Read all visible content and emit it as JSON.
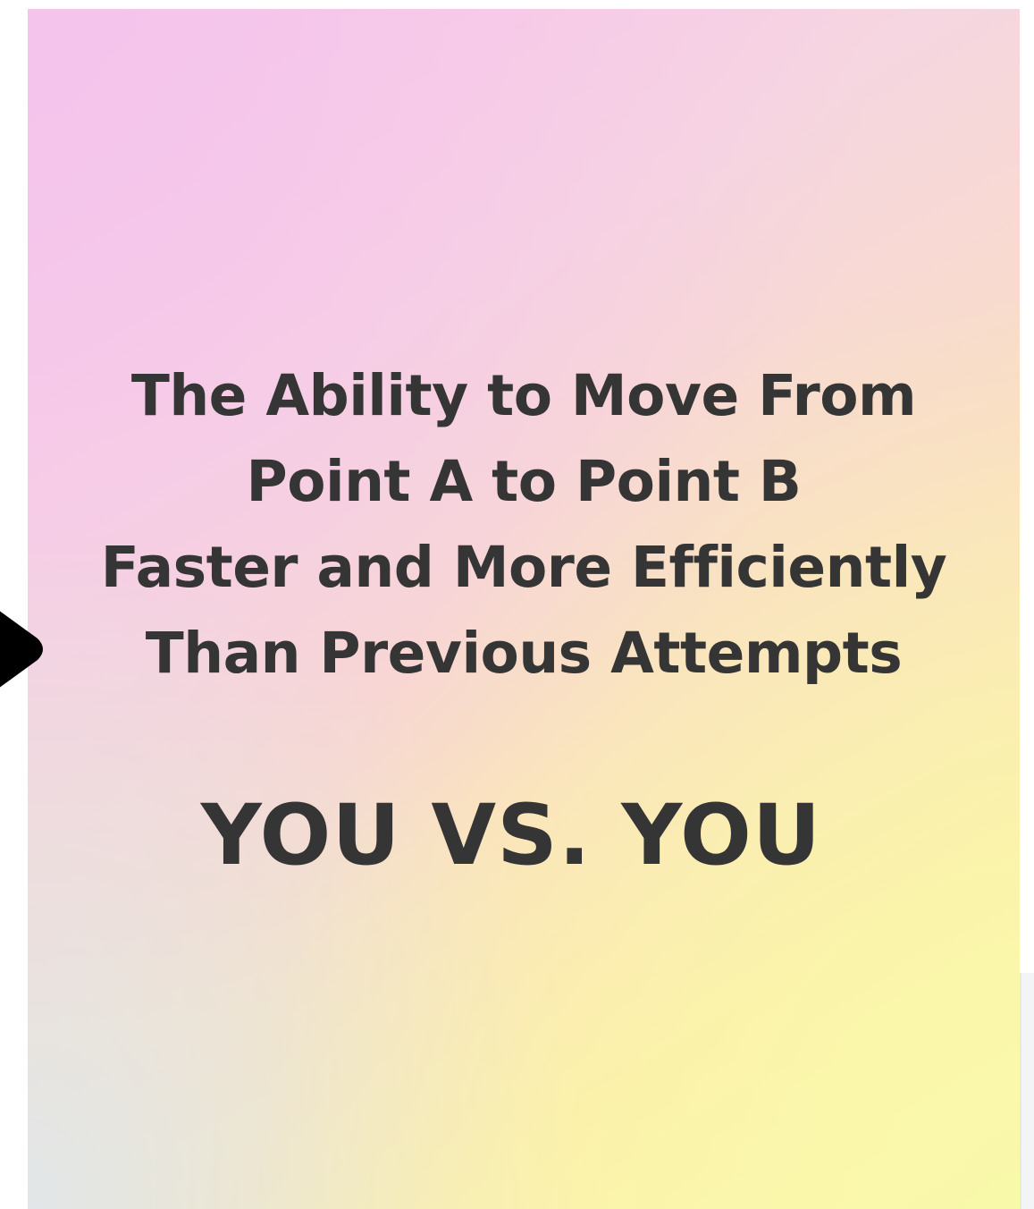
{
  "slide": {
    "subtitle_lines": [
      "The Ability to Move From",
      "Point A to Point B",
      "Faster and More Efficiently",
      "Than Previous Attempts"
    ],
    "headline": "YOU VS. YOU"
  },
  "controls": {
    "prev_arrow_icon": "play-right-icon"
  },
  "colors": {
    "text": "#353535",
    "gradient_top_left": "#f5c4ec",
    "gradient_bottom_right": "#f9f9aa"
  }
}
